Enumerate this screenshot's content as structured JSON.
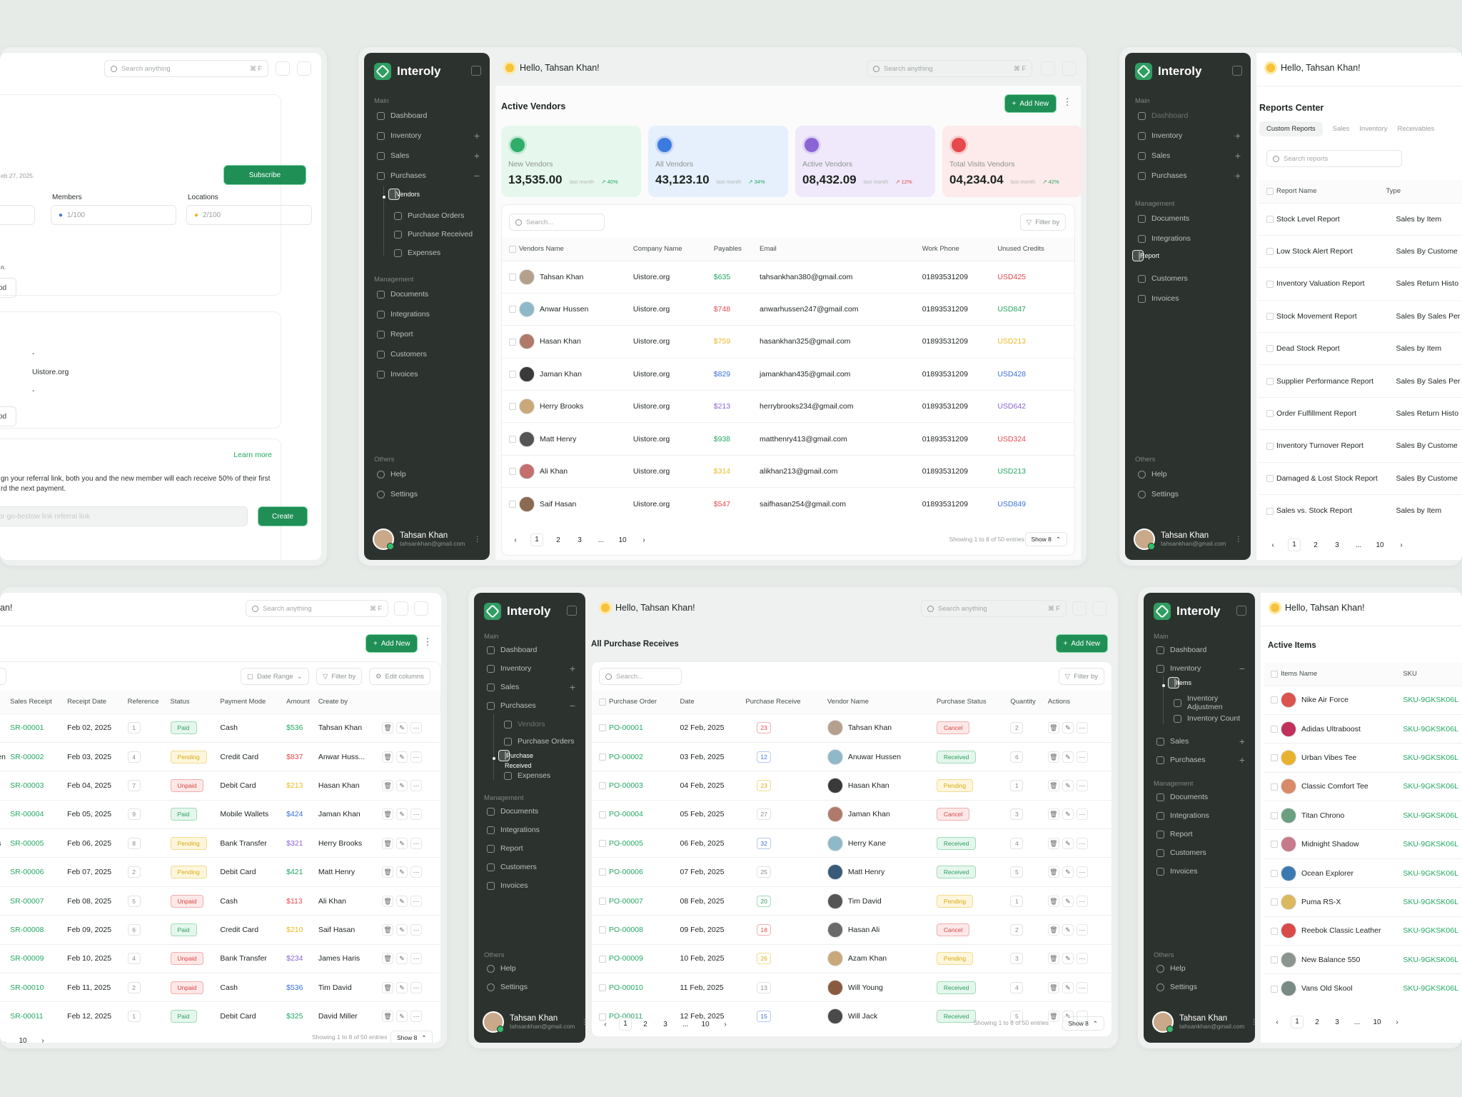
{
  "app": {
    "brand": "Interoly",
    "greeting": "Hello, Tahsan Khan!",
    "greeting_cut": "an!",
    "search_placeholder": "Search anything",
    "shortcut": "⌘ F",
    "user_name": "Tahsan Khan",
    "user_email": "tahsankhan@gmail.com",
    "add_new": "Add New",
    "filter_by": "Filter by",
    "search_short": "Search...",
    "showing": "Showing 1 to 8 of 50 entries",
    "show8": "Show 8",
    "pages": [
      "1",
      "2",
      "3",
      "...",
      "10"
    ]
  },
  "sidebar": {
    "main": "Main",
    "management": "Management",
    "others": "Others",
    "dashboard": "Dashboard",
    "inventory": "Inventory",
    "sales": "Sales",
    "purchases": "Purchases",
    "vendors": "Vendors",
    "purchase_orders": "Purchase Orders",
    "purchase_received": "Purchase Received",
    "expenses": "Expenses",
    "documents": "Documents",
    "integrations": "Integrations",
    "report": "Report",
    "customers": "Customers",
    "invoices": "Invoices",
    "help": "Help",
    "settings": "Settings",
    "items": "Items",
    "inv_adjust": "Inventory Adjustmen",
    "inv_count": "Inventory Count"
  },
  "vendors": {
    "title": "Active Vendors",
    "stats": [
      {
        "label": "New Vendors",
        "value": "13,535.00",
        "meta": "last month",
        "pct": "40%",
        "color": "#2fae6a",
        "bg": "#e6f8ee",
        "pc": "g"
      },
      {
        "label": "All Vendors",
        "value": "43,123.10",
        "meta": "last month",
        "pct": "34%",
        "color": "#3b7be0",
        "bg": "#e6effc",
        "pc": "g"
      },
      {
        "label": "Active Vendors",
        "value": "08,432.09",
        "meta": "last month",
        "pct": "12%",
        "color": "#8b65d4",
        "bg": "#efe9fb",
        "pc": "r"
      },
      {
        "label": "Total Visits Vendors",
        "value": "04,234.04",
        "meta": "last month",
        "pct": "42%",
        "color": "#e5484d",
        "bg": "#fdeaea",
        "pc": "g"
      }
    ],
    "columns": [
      "Vendors Name",
      "Company Name",
      "Payables",
      "Email",
      "Work Phone",
      "Unused Credits"
    ],
    "rows": [
      {
        "name": "Tahsan Khan",
        "company": "Uistore.org",
        "pay": "$635",
        "pc": "g",
        "email": "tahsankhan380@gmail.com",
        "phone": "01893531209",
        "credit": "USD425",
        "cc": "r",
        "av": "#b5a08e"
      },
      {
        "name": "Anwar Hussen",
        "company": "Uistore.org",
        "pay": "$748",
        "pc": "r",
        "email": "anwarhussen247@gmail.com",
        "phone": "01893531209",
        "credit": "USD847",
        "cc": "g",
        "av": "#8fb8c9"
      },
      {
        "name": "Hasan Khan",
        "company": "Uistore.org",
        "pay": "$759",
        "pc": "y",
        "email": "hasankhan325@gmail.com",
        "phone": "01893531209",
        "credit": "USD213",
        "cc": "y",
        "av": "#b07a6a"
      },
      {
        "name": "Jaman Khan",
        "company": "Uistore.org",
        "pay": "$829",
        "pc": "b",
        "email": "jamankhan435@gmail.com",
        "phone": "01893531209",
        "credit": "USD428",
        "cc": "b",
        "av": "#3a3a3a"
      },
      {
        "name": "Herry Brooks",
        "company": "Uistore.org",
        "pay": "$213",
        "pc": "p",
        "email": "herrybrooks234@gmail.com",
        "phone": "01893531209",
        "credit": "USD642",
        "cc": "p",
        "av": "#c9a87a"
      },
      {
        "name": "Matt Henry",
        "company": "Uistore.org",
        "pay": "$938",
        "pc": "g",
        "email": "matthenry413@gmail.com",
        "phone": "01893531209",
        "credit": "USD324",
        "cc": "r",
        "av": "#555"
      },
      {
        "name": "Ali Khan",
        "company": "Uistore.org",
        "pay": "$314",
        "pc": "y",
        "email": "alikhan213@gmail.com",
        "phone": "01893531209",
        "credit": "USD213",
        "cc": "g",
        "av": "#c46e6e"
      },
      {
        "name": "Saif Hasan",
        "company": "Uistore.org",
        "pay": "$547",
        "pc": "r",
        "email": "saifhasan254@gmail.com",
        "phone": "01893531209",
        "credit": "USD849",
        "cc": "b",
        "av": "#8a6a50"
      }
    ]
  },
  "reports": {
    "title": "Reports Center",
    "tabs": [
      "Custom Reports",
      "Sales",
      "Inventory",
      "Receivables"
    ],
    "search": "Search reports",
    "columns": [
      "Report Name",
      "Type"
    ],
    "rows": [
      {
        "name": "Stock Level Report",
        "type": "Sales by Item"
      },
      {
        "name": "Low Stock Alert Report",
        "type": "Sales By Custome"
      },
      {
        "name": "Inventory Valuation Report",
        "type": "Sales Return Histo"
      },
      {
        "name": "Stock Movement Report",
        "type": "Sales By Sales Per"
      },
      {
        "name": "Dead Stock Report",
        "type": "Sales by Item"
      },
      {
        "name": "Supplier Performance Report",
        "type": "Sales By Sales Per"
      },
      {
        "name": "Order Fulfillment Report",
        "type": "Sales Return Histo"
      },
      {
        "name": "Inventory Turnover Report",
        "type": "Sales By Custome"
      },
      {
        "name": "Damaged & Lost Stock Report",
        "type": "Sales By Custome"
      },
      {
        "name": "Sales vs. Stock Report",
        "type": "Sales by Item"
      }
    ]
  },
  "settings": {
    "date": "eb 27, 2025.",
    "subscribe": "Subscribe",
    "members": "Members",
    "locations": "Locations",
    "members_val": "1/100",
    "locations_val": "2/100",
    "cut1": "n.",
    "cut2": "od",
    "dash": "-",
    "company": "Uistore.org",
    "dash2": "-",
    "cut3": "od",
    "learn_more": "Learn more",
    "referral": "gn your referral link, both you and the new member will each receive 50% of their first",
    "referral2": "rd the next payment.",
    "link_placeholder": "or go-bestow link referral link",
    "create": "Create"
  },
  "sales": {
    "date_range": "Date Range",
    "edit_columns": "Edit columns",
    "columns": [
      "Sales Receipt",
      "Receipt Date",
      "Reference",
      "Status",
      "Payment Mode",
      "Amount",
      "Create by"
    ],
    "rows": [
      {
        "cut": "n",
        "id": "SR-00001",
        "date": "Feb 02, 2025",
        "ref": "1",
        "status": "Paid",
        "sc": "b-paid",
        "mode": "Cash",
        "amt": "$536",
        "ac": "g",
        "by": "Tahsan Khan"
      },
      {
        "cut": "sen",
        "id": "SR-00002",
        "date": "Feb 03, 2025",
        "ref": "4",
        "status": "Pending",
        "sc": "b-pen",
        "mode": "Credit Card",
        "amt": "$837",
        "ac": "r",
        "by": "Anwar Huss..."
      },
      {
        "cut": "n",
        "id": "SR-00003",
        "date": "Feb 04, 2025",
        "ref": "7",
        "status": "Unpaid",
        "sc": "b-unp",
        "mode": "Debit Card",
        "amt": "$213",
        "ac": "y",
        "by": "Hasan Khan"
      },
      {
        "cut": "n",
        "id": "SR-00004",
        "date": "Feb 05, 2025",
        "ref": "9",
        "status": "Paid",
        "sc": "b-paid",
        "mode": "Mobile Wallets",
        "amt": "$424",
        "ac": "b",
        "by": "Jaman Khan"
      },
      {
        "cut": "ks",
        "id": "SR-00005",
        "date": "Feb 06, 2025",
        "ref": "8",
        "status": "Pending",
        "sc": "b-pen",
        "mode": "Bank Transfer",
        "amt": "$321",
        "ac": "p",
        "by": "Herry Brooks"
      },
      {
        "cut": "",
        "id": "SR-00006",
        "date": "Feb 07, 2025",
        "ref": "2",
        "status": "Pending",
        "sc": "b-pen",
        "mode": "Debit Card",
        "amt": "$421",
        "ac": "g",
        "by": "Matt Henry"
      },
      {
        "cut": "",
        "id": "SR-00007",
        "date": "Feb 08, 2025",
        "ref": "5",
        "status": "Unpaid",
        "sc": "b-unp",
        "mode": "Cash",
        "amt": "$113",
        "ac": "r",
        "by": "Ali Khan"
      },
      {
        "cut": "",
        "id": "SR-00008",
        "date": "Feb 09, 2025",
        "ref": "6",
        "status": "Paid",
        "sc": "b-paid",
        "mode": "Credit Card",
        "amt": "$210",
        "ac": "y",
        "by": "Saif Hasan"
      },
      {
        "cut": "s",
        "id": "SR-00009",
        "date": "Feb 10, 2025",
        "ref": "4",
        "status": "Unpaid",
        "sc": "b-unp",
        "mode": "Bank Transfer",
        "amt": "$234",
        "ac": "p",
        "by": "James Haris"
      },
      {
        "cut": "",
        "id": "SR-00010",
        "date": "Feb 11, 2025",
        "ref": "2",
        "status": "Unpaid",
        "sc": "b-unp",
        "mode": "Cash",
        "amt": "$536",
        "ac": "b",
        "by": "Tim David"
      },
      {
        "cut": "",
        "id": "SR-00011",
        "date": "Feb 12, 2025",
        "ref": "1",
        "status": "Paid",
        "sc": "b-paid",
        "mode": "Debit Card",
        "amt": "$325",
        "ac": "g",
        "by": "David Miller"
      }
    ]
  },
  "receives": {
    "title": "All Purchase Receives",
    "columns": [
      "Purchase Order",
      "Date",
      "Purchase Receive",
      "Vendor Name",
      "Purchase Status",
      "Quantity",
      "Actions"
    ],
    "rows": [
      {
        "po": "PO-00001",
        "date": "02 Feb, 2025",
        "rec": "23",
        "rc": "r",
        "vendor": "Tahsan Khan",
        "status": "Cancel",
        "sc": "b-can",
        "qty": "2",
        "av": "#b5a08e"
      },
      {
        "po": "PO-00002",
        "date": "03 Feb, 2025",
        "rec": "12",
        "rc": "b",
        "vendor": "Anuwar Hussen",
        "status": "Received",
        "sc": "b-rec",
        "qty": "6",
        "av": "#8fb8c9"
      },
      {
        "po": "PO-00003",
        "date": "04 Feb, 2025",
        "rec": "23",
        "rc": "y",
        "vendor": "Hasan Khan",
        "status": "Pending",
        "sc": "b-pen",
        "qty": "1",
        "av": "#3a3a3a"
      },
      {
        "po": "PO-00004",
        "date": "05 Feb, 2025",
        "rec": "27",
        "rc": "",
        "vendor": "Jaman Khan",
        "status": "Cancel",
        "sc": "b-can",
        "qty": "3",
        "av": "#b07a6a"
      },
      {
        "po": "PO-00005",
        "date": "06 Feb, 2025",
        "rec": "32",
        "rc": "b",
        "vendor": "Herry Kane",
        "status": "Received",
        "sc": "b-rec",
        "qty": "4",
        "av": "#8fb8c9"
      },
      {
        "po": "PO-00006",
        "date": "07 Feb, 2025",
        "rec": "25",
        "rc": "",
        "vendor": "Matt Henry",
        "status": "Received",
        "sc": "b-rec",
        "qty": "5",
        "av": "#3a5a7a"
      },
      {
        "po": "PO-00007",
        "date": "08 Feb, 2025",
        "rec": "20",
        "rc": "g",
        "vendor": "Tim David",
        "status": "Pending",
        "sc": "b-pen",
        "qty": "1",
        "av": "#555"
      },
      {
        "po": "PO-00008",
        "date": "09 Feb, 2025",
        "rec": "18",
        "rc": "r",
        "vendor": "Hasan Ali",
        "status": "Cancel",
        "sc": "b-can",
        "qty": "2",
        "av": "#6a6a6a"
      },
      {
        "po": "PO-00009",
        "date": "10 Feb, 2025",
        "rec": "26",
        "rc": "y",
        "vendor": "Azam Khan",
        "status": "Pending",
        "sc": "b-pen",
        "qty": "3",
        "av": "#c9a87a"
      },
      {
        "po": "PO-00010",
        "date": "11 Feb, 2025",
        "rec": "13",
        "rc": "",
        "vendor": "Will Young",
        "status": "Received",
        "sc": "b-rec",
        "qty": "4",
        "av": "#8a5a40"
      },
      {
        "po": "PO-00011",
        "date": "12 Feb, 2025",
        "rec": "15",
        "rc": "b",
        "vendor": "Will Jack",
        "status": "Received",
        "sc": "b-rec",
        "qty": "5",
        "av": "#4a4a4a"
      }
    ]
  },
  "items": {
    "title": "Active Items",
    "columns": [
      "Items Name",
      "SKU"
    ],
    "rows": [
      {
        "name": "Nike Air Force",
        "sku": "SKU-9GKSK06L",
        "av": "#d9534f"
      },
      {
        "name": "Adidas Ultraboost",
        "sku": "SKU-9GKSK06L",
        "av": "#c0305a"
      },
      {
        "name": "Urban Vibes Tee",
        "sku": "SKU-9GKSK06L",
        "av": "#e8b22e"
      },
      {
        "name": "Classic Comfort Tee",
        "sku": "SKU-9GKSK06L",
        "av": "#d98a6a"
      },
      {
        "name": "Titan Chrono",
        "sku": "SKU-9GKSK06L",
        "av": "#6aa080"
      },
      {
        "name": "Midnight Shadow",
        "sku": "SKU-9GKSK06L",
        "av": "#c77a8a"
      },
      {
        "name": "Ocean Explorer",
        "sku": "SKU-9GKSK06L",
        "av": "#3a7ab0"
      },
      {
        "name": "Puma RS-X",
        "sku": "SKU-9GKSK06L",
        "av": "#d9b860"
      },
      {
        "name": "Reebok Classic Leather",
        "sku": "SKU-9GKSK06L",
        "av": "#d94a4a"
      },
      {
        "name": "New Balance 550",
        "sku": "SKU-9GKSK06L",
        "av": "#8a9590"
      },
      {
        "name": "Vans Old Skool",
        "sku": "SKU-9GKSK06L",
        "av": "#7a8a85"
      }
    ]
  }
}
